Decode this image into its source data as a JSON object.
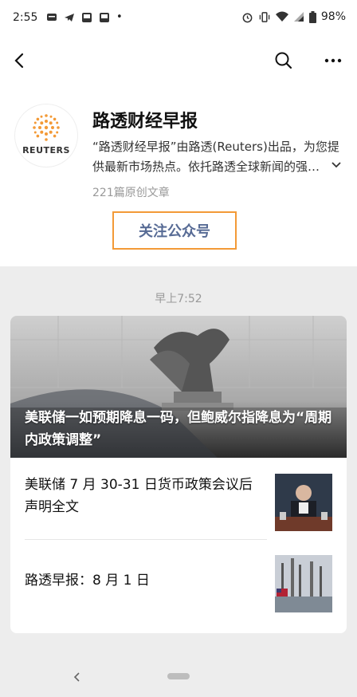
{
  "status_bar": {
    "time": "2:55",
    "dot": "•",
    "battery": "98%",
    "icons": [
      "message-icon",
      "telegram-icon",
      "app-icon",
      "app-icon",
      "alarm-icon",
      "vibrate-icon",
      "wifi-icon",
      "signal-icon",
      "battery-icon"
    ]
  },
  "nav": {
    "back_icon": "chevron-left-icon",
    "search_icon": "search-icon",
    "more_icon": "more-dots-icon"
  },
  "account": {
    "logo_text": "REUTERS",
    "name": "路透财经早报",
    "description": "“路透财经早报”由路透(Reuters)出品，为您提供最新市场热点。依托路透全球新闻的强…",
    "article_count": "221篇原创文章",
    "follow_label": "关注公众号",
    "colors": {
      "follow_border": "#f39a37",
      "follow_text": "#576b95"
    }
  },
  "feed": {
    "time": "早上7:52",
    "hero_title": "美联储一如预期降息一码，但鲍威尔指降息为“周期内政策调整”",
    "items": [
      {
        "title": "美联储 7 月 30-31 日货币政策会议后声明全文"
      },
      {
        "title": "路透早报：8 月 1 日"
      }
    ]
  }
}
